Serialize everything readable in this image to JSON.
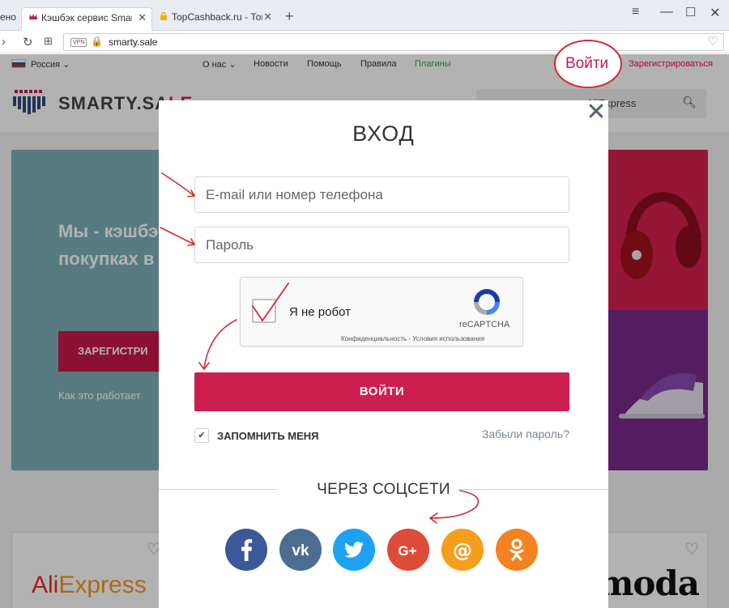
{
  "browser": {
    "tabs": [
      {
        "label": "ено"
      },
      {
        "label": "Кэшбэк сервис Smarty.Sale"
      },
      {
        "label": "TopCashback.ru - Топ лучших"
      }
    ],
    "address": {
      "vpn": "VPN",
      "url": "smarty.sale"
    }
  },
  "topnav": {
    "region": "Россия",
    "about": "О нас",
    "news": "Новости",
    "help": "Помощь",
    "rules": "Правила",
    "plugins": "Плагины",
    "login": "Войти",
    "register": "Зарегистрироваться"
  },
  "header": {
    "logo_a": "SMARTY.SA",
    "logo_b": "LE",
    "search_value": "AliExpress"
  },
  "hero": {
    "title": "Мы - кэшбэ котором вы покупках в интернет-ма",
    "button": "ЗАРЕГИСТРИ",
    "link": "Как это работает"
  },
  "cards": {
    "aliexpress_a": "Ali",
    "aliexpress_b": "Express",
    "moda": "moda"
  },
  "modal": {
    "title": "ВХОД",
    "email_placeholder": "E-mail или номер телефона",
    "password_placeholder": "Пароль",
    "captcha_label": "Я не робот",
    "captcha_brand": "reCAPTCHA",
    "captcha_terms": "Конфиденциальность - Условия использования",
    "submit": "ВОЙТИ",
    "remember": "ЗАПОМНИТЬ МЕНЯ",
    "forgot": "Забыли пароль?",
    "social_title": "ЧЕРЕЗ СОЦСЕТИ",
    "social": [
      {
        "name": "facebook",
        "color": "#3b5998"
      },
      {
        "name": "vk",
        "color": "#4c6c91"
      },
      {
        "name": "twitter",
        "color": "#1da1f2"
      },
      {
        "name": "google-plus",
        "color": "#dd4b39"
      },
      {
        "name": "mail-ru",
        "color": "#f59e1c"
      },
      {
        "name": "odnoklassniki",
        "color": "#f58220"
      }
    ]
  },
  "colors": {
    "accent": "#cc1f4f",
    "annotation": "#d12a36"
  }
}
